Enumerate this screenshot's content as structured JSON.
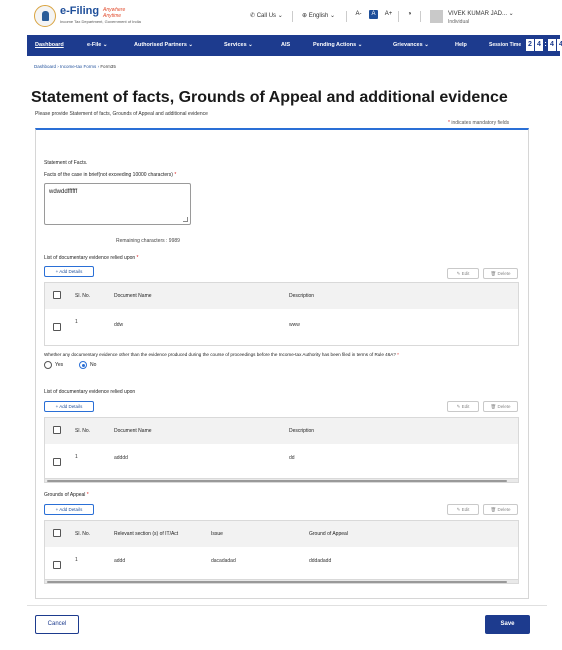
{
  "header": {
    "logo_title": "e-Filing",
    "logo_tagline": "Anywhere Anytime",
    "logo_subtitle": "Income Tax Department, Government of India",
    "call_us": "Call Us",
    "language": "English",
    "font_small": "A-",
    "font_normal": "A",
    "font_large": "A+",
    "contrast": "◑",
    "user_name": "VIVEK KUMAR JAD...",
    "user_role": "Individual"
  },
  "nav": {
    "items": [
      "Dashboard",
      "e-File",
      "Authorised Partners",
      "Services",
      "AIS",
      "Pending Actions",
      "Grievances",
      "Help"
    ],
    "session_label": "Session Time",
    "timer": [
      "2",
      "4",
      ":",
      "4",
      "4"
    ]
  },
  "breadcrumb": [
    "Dashboard",
    "Income-tax Forms",
    "Form35"
  ],
  "page": {
    "title": "Statement of facts, Grounds of Appeal and additional evidence",
    "subtitle": "Please provide Statement of facts, Grounds of Appeal and additional evidence",
    "mandatory_note": "indicates mandatory fields"
  },
  "facts": {
    "section_title": "Statement of Facts.",
    "field_label": "Facts of the case in brief(not exceeding 10000 characters)",
    "value": "wdwddffffff",
    "remaining": "Remaining characters : 9989"
  },
  "doc_evidence": {
    "title": "List of documentary evidence relied upon",
    "add_label": "+ Add Details",
    "edit_label": "✎ Edit",
    "delete_label": "🗑 Delete",
    "columns": [
      "Sl. No.",
      "Document Name",
      "Description"
    ],
    "rows": [
      [
        "1",
        "ddw",
        "www"
      ]
    ]
  },
  "question": {
    "text": "Whether any documentary evidence other than the evidence produced during the course of proceedings before the Income-tax Authority has been filed in terms of Rule 46A?",
    "options": [
      "Yes",
      "No"
    ],
    "selected": "No"
  },
  "additional_evidence": {
    "title": "List of documentary evidence relied upon",
    "add_label": "+ Add Details",
    "edit_label": "✎ Edit",
    "delete_label": "🗑 Delete",
    "columns": [
      "Sl. No.",
      "Document Name",
      "Description"
    ],
    "rows": [
      [
        "1",
        "adddd",
        "dd"
      ]
    ]
  },
  "grounds": {
    "title": "Grounds of Appeal",
    "add_label": "+ Add Details",
    "edit_label": "✎ Edit",
    "delete_label": "🗑 Delete",
    "columns": [
      "Sl. No.",
      "Relevant section (s) of IT/Act",
      "Issue",
      "Ground of Appeal"
    ],
    "rows": [
      [
        "1",
        "addd",
        "dacadadad",
        "dddadadd"
      ]
    ]
  },
  "footer": {
    "cancel_label": "Cancel",
    "save_label": "Save"
  },
  "colors": {
    "nav_bg": "#1d3b8e",
    "accent": "#2a6fd6",
    "required": "#dd2222"
  }
}
